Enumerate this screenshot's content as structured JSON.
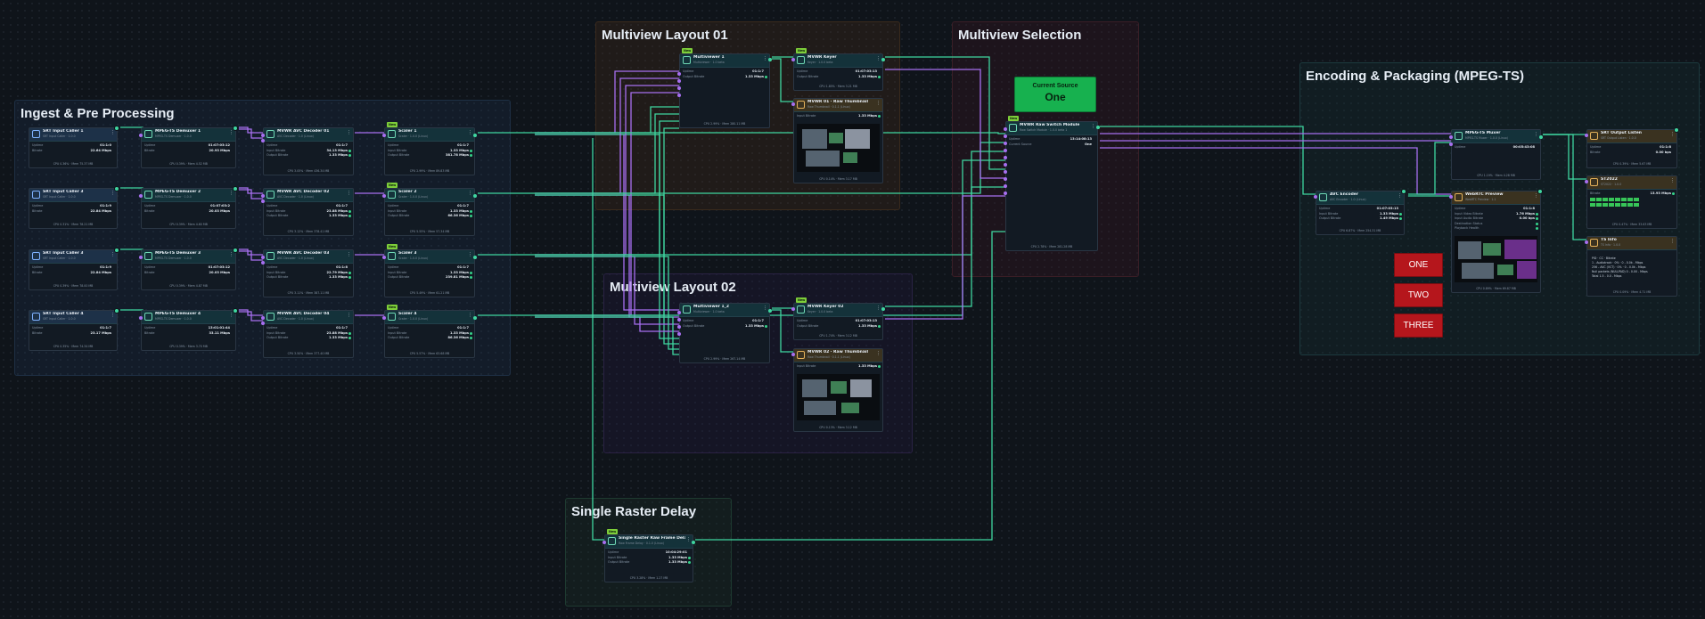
{
  "groups": {
    "ingest": "Ingest & Pre Processing",
    "mv1": "Multiview Layout 01",
    "mvsel": "Multiview Selection",
    "mv2": "Multiview Layout 02",
    "delay": "Single Raster Delay",
    "encoding": "Encoding & Packaging (MPEG-TS)"
  },
  "labels": {
    "uptime": "Uptime",
    "bitrate": "Bitrate",
    "input_bitrate": "Input Bitrate",
    "output_bitrate": "Output Bitrate",
    "cpu": "CPU",
    "mem": "Mem",
    "current_source": "Current Source",
    "new": "New",
    "input_video": "Input Video Bitrate",
    "input_audio": "Input Audio Bitrate",
    "destination": "Destination Status",
    "playback": "Playback Health"
  },
  "ingest_rows": [
    {
      "srt": {
        "title": "SRT Input Caller 1",
        "sub": "SRT Input Caller · 1.0.0",
        "uptime": "01:1:0",
        "bitrate": "22.64 Mbps",
        "cpu": "0.36%",
        "mem": "75.37 MB"
      },
      "demux": {
        "title": "MPEG-TS Demuxer 1",
        "sub": "MPEG-TS Demuxer · 1.0.0",
        "val": "01:07:03:12",
        "br": "20.93 Mbps",
        "cpu": "0.39%",
        "mem": "4.52 MB"
      },
      "dec": {
        "title": "MVWR AVC Decoder 01",
        "sub": "AVC Decoder · 1.0 (Linux)",
        "uptime": "01:1:7",
        "in": "34.13 Mbps",
        "out": "1.33 Mbps",
        "cpu": "3.05%",
        "mem": "436.34 MB"
      },
      "scaler": {
        "title": "Scaler 1",
        "sub": "Scaler · 1.0.0 (Linux)",
        "uptime": "01:1:7",
        "in": "1.33 Mbps",
        "out": "381.78 Mbps",
        "cpu": "2.99%",
        "mem": "89.83 MB"
      }
    },
    {
      "srt": {
        "title": "SRT Input Caller 3",
        "sub": "SRT Input Caller · 1.0.0",
        "uptime": "01:1:9",
        "bitrate": "22.84 Mbps",
        "cpu": "0.31%",
        "mem": "78.21 MB"
      },
      "demux": {
        "title": "MPEG-TS Demuxer 2",
        "sub": "MPEG-TS Demuxer · 1.0.0",
        "val": "01:07:03:2",
        "br": "20.03 Mbps",
        "cpu": "0.39%",
        "mem": "4.60 MB"
      },
      "dec": {
        "title": "MVWR AVC Decoder 02",
        "sub": "AVC Decoder · 1.0 (Linux)",
        "uptime": "01:1:7",
        "in": "23.88 Mbps",
        "out": "1.33 Mbps",
        "cpu": "3.12%",
        "mem": "378.41 MB"
      },
      "scaler": {
        "title": "Scaler 2",
        "sub": "Scaler · 1.0.0 (Linux)",
        "uptime": "01:1:7",
        "in": "1.33 Mbps",
        "out": "66.36 Mbps",
        "cpu": "5.55%",
        "mem": "57.34 MB"
      }
    },
    {
      "srt": {
        "title": "SRT Input Caller 3",
        "sub": "SRT Input Caller · 1.0.0",
        "uptime": "01:1:9",
        "bitrate": "22.84 Mbps",
        "cpu": "0.39%",
        "mem": "78.00 MB"
      },
      "demux": {
        "title": "MPEG-TS Demuxer 3",
        "sub": "MPEG-TS Demuxer · 1.0.0",
        "val": "01:07:03:12",
        "br": "20.03 Mbps",
        "cpu": "0.39%",
        "mem": "4.87 MB"
      },
      "dec": {
        "title": "MVWR AVC Decoder 03",
        "sub": "AVC Decoder · 1.0 (Linux)",
        "uptime": "01:1:8",
        "in": "22.79 Mbps",
        "out": "1.33 Mbps",
        "cpu": "3.11%",
        "mem": "387.11 MB"
      },
      "scaler": {
        "title": "Scaler 3",
        "sub": "Scaler · 1.0.0 (Linux)",
        "uptime": "01:1:7",
        "in": "1.33 Mbps",
        "out": "239.81 Mbps",
        "cpu": "5.49%",
        "mem": "61.21 MB"
      }
    },
    {
      "srt": {
        "title": "SRT Input Caller 4",
        "sub": "SRT Input Caller · 1.0.0",
        "uptime": "01:1:7",
        "bitrate": "23.17 Mbps",
        "cpu": "0.35%",
        "mem": "74.34 MB"
      },
      "demux": {
        "title": "MPEG-TS Demuxer 4",
        "sub": "MPEG-TS Demuxer · 1.0.0",
        "val": "13:01:01:44",
        "br": "33.11 Mbps",
        "cpu": "0.39%",
        "mem": "3.70 MB"
      },
      "dec": {
        "title": "MVWR AVC Decoder 04",
        "sub": "AVC Decoder · 1.0 (Linux)",
        "uptime": "01:1:7",
        "in": "23.88 Mbps",
        "out": "1.33 Mbps",
        "cpu": "3.50%",
        "mem": "377.40 MB"
      },
      "scaler": {
        "title": "Scaler 4",
        "sub": "Scaler · 1.0.0 (Linux)",
        "uptime": "01:1:7",
        "in": "1.33 Mbps",
        "out": "86.36 Mbps",
        "cpu": "5.57%",
        "mem": "63.68 MB"
      }
    }
  ],
  "mv1": {
    "mux": {
      "title": "Multiviewer 1",
      "sub": "Multiviewer · 1.0 beta",
      "uptime": "01:1:7",
      "out": "1.33 Mbps",
      "cpu": "2.99%",
      "mem": "280.11 MB"
    },
    "keyer": {
      "title": "MVWR Keyer",
      "sub": "Keyer · 1.0.0 beta",
      "uptime": "01:07:03:13",
      "out": "1.33 Mbps",
      "cpu": "1.85%",
      "mem": "3.21 MB"
    },
    "thumb": {
      "title": "MVWR 01 · Raw Thumbnail",
      "sub": "Raw Thumbnail · 0.1.1 (Linux)",
      "in": "1.33 Mbps",
      "cpu": "0.14%",
      "mem": "3.17 MB"
    }
  },
  "mv2": {
    "mux": {
      "title": "Multiviewer 1_2",
      "sub": "Multiviewer · 1.0 beta",
      "uptime": "01:1:7",
      "out": "1.33 Mbps",
      "cpu": "2.99%",
      "mem": "267.14 MB"
    },
    "keyer": {
      "title": "MVWR Keyer 02",
      "sub": "Keyer · 1.0.0 beta",
      "uptime": "01:07:03:13",
      "out": "1.33 Mbps",
      "cpu": "1.74%",
      "mem": "3.12 MB"
    },
    "thumb": {
      "title": "MVWR 02 · Raw Thumbnail",
      "sub": "Raw Thumbnail · 0.1.1 (Linux)",
      "in": "1.33 Mbps",
      "cpu": "0.13%",
      "mem": "3.12 MB"
    }
  },
  "mvsel": {
    "current_source_value": "One",
    "switch": {
      "title": "MVWR Raw Switch Module",
      "sub": "Raw Switch Module · 1.0.0 beta 1",
      "uptime": "13:14:08:13",
      "source": "One",
      "cpu": "2.78%",
      "mem": "281.28 MB"
    }
  },
  "delay": {
    "title": "Single Raster Raw Frame Delay",
    "sub": "Raw Frame Delay · 0.1.0 (Linux)",
    "uptime": "10:04:29:01",
    "in": "1.33 Mbps",
    "out": "1.33 Mbps",
    "cpu": "3.28%",
    "mem": "1.27 MB"
  },
  "encoding": {
    "avc": {
      "title": "AVC Encoder",
      "sub": "AVC Encoder · 1.0 (Linux)",
      "uptime": "01:07:03:13",
      "in": "1.33 Mbps",
      "out": "1.49 Mbps",
      "cpu": "6.87%",
      "mem": "254.31 MB"
    },
    "tsmux": {
      "title": "MPEG-TS Muxer",
      "sub": "MPEG-TS Muxer · 1.0.0 (Linux)",
      "uptime": "00:05:43:08",
      "cpu": "1.19%",
      "mem": "4.28 MB"
    },
    "webrtc": {
      "title": "WebRTC Preview",
      "sub": "WebRTC Preview · 1.1",
      "uptime": "01:1:8",
      "video": "1.76 Mbps",
      "audio": "0.00 bps",
      "cpu": "0.89%",
      "mem": "69.87 MB"
    },
    "srtout": {
      "title": "SRT Output Listen",
      "sub": "SRT Output Listen · 1.0.0",
      "uptime": "01:1:8",
      "bitrate": "0.00 bps",
      "cpu": "0.39%",
      "mem": "5.67 MB"
    },
    "st2110": {
      "title": "ST2022",
      "sub": "ST2022 · 1.0.0",
      "bitrate": "13.93 Mbps",
      "cpu": "0.47%",
      "mem": "33.63 MB"
    },
    "tsinfo": {
      "title": "TS Info",
      "sub": "TS Info · 1.0.0",
      "cpu": "0.09%",
      "mem": "4.71 MB",
      "rows": [
        {
          "pid": "PID",
          "cc": "CC",
          "bitrate": "Bitrate"
        },
        {
          "pid": "1 - Audiotrack",
          "cc": "0%",
          "bitrate": "0 - 0.0k - Mbps"
        },
        {
          "pid": "256 - AVC (VCT)",
          "cc": "0%",
          "bitrate": "0 - 0.0k - Mbps"
        },
        {
          "pid": "Null packets (NULLPAD)",
          "cc": "",
          "bitrate": "0 - 0.00 - Mbps"
        },
        {
          "pid": "Total",
          "cc": "",
          "bitrate": "1.5 - 0.0 - Mbps"
        }
      ]
    }
  },
  "buttons": {
    "one": "ONE",
    "two": "TWO",
    "three": "THREE"
  },
  "icons": {
    "node": "module-icon",
    "menu": "kebab-menu-icon"
  },
  "colors": {
    "video_edge": "#3fd6a0",
    "audio_edge": "#a76ff0",
    "badge": "#7ecf3a",
    "source_green": "#17b14f",
    "button_red": "#b5161c"
  }
}
